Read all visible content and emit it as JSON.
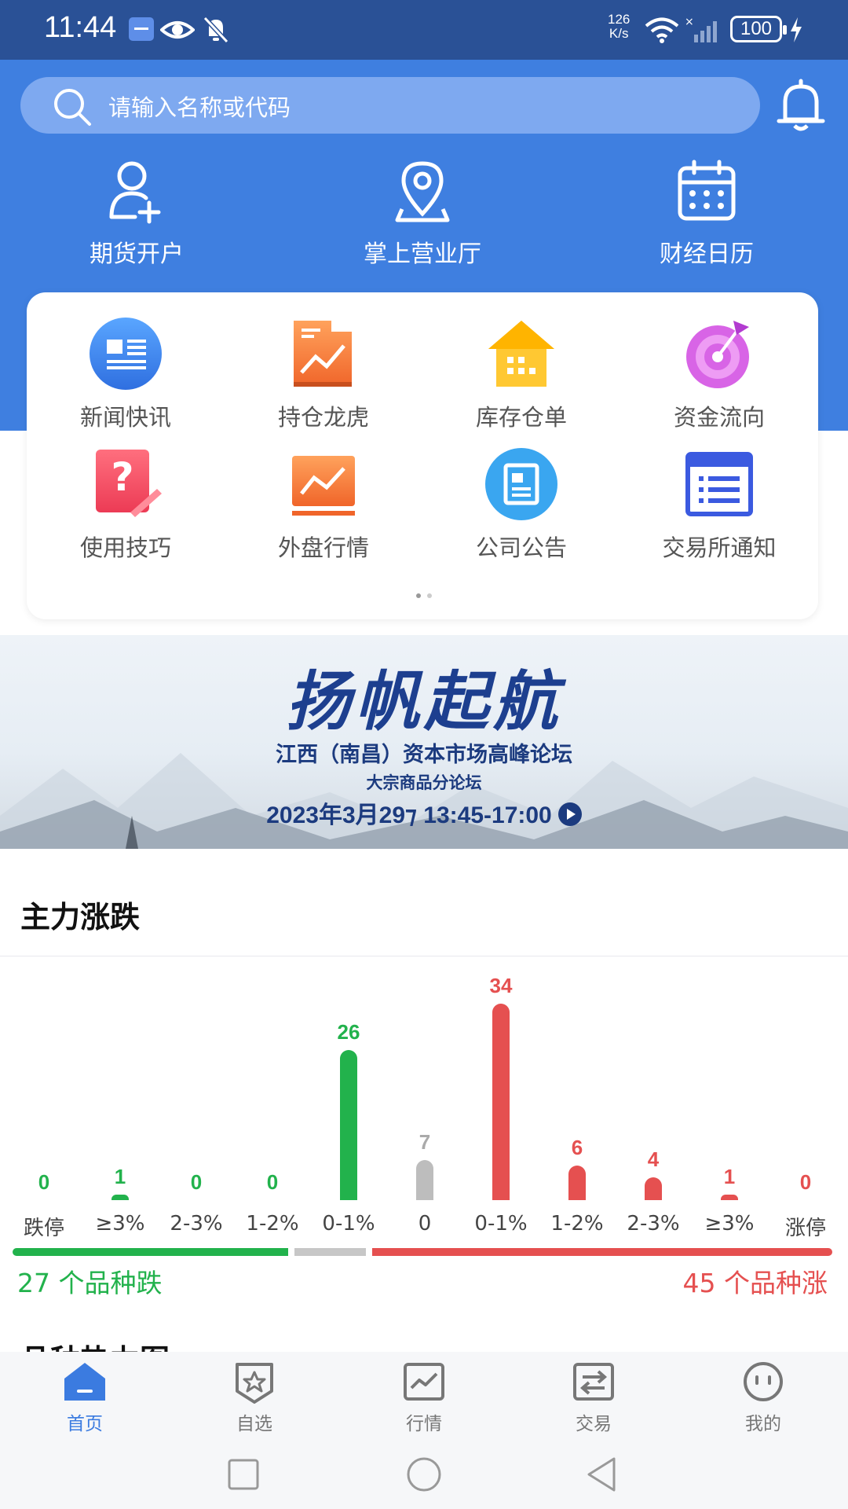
{
  "status_bar": {
    "time": "11:44",
    "net_speed_top": "126",
    "net_speed_bottom": "K/s",
    "battery": "100"
  },
  "search": {
    "placeholder": "请输入名称或代码"
  },
  "top_nav": [
    {
      "label": "期货开户",
      "icon": "add-user-icon"
    },
    {
      "label": "掌上营业厅",
      "icon": "location-pin-icon"
    },
    {
      "label": "财经日历",
      "icon": "calendar-icon"
    }
  ],
  "grid": [
    {
      "label": "新闻快讯",
      "icon": "news-icon"
    },
    {
      "label": "持仓龙虎",
      "icon": "position-chart-icon"
    },
    {
      "label": "库存仓单",
      "icon": "warehouse-icon"
    },
    {
      "label": "资金流向",
      "icon": "target-icon"
    },
    {
      "label": "使用技巧",
      "icon": "help-icon"
    },
    {
      "label": "外盘行情",
      "icon": "market-trend-icon"
    },
    {
      "label": "公司公告",
      "icon": "announcement-icon"
    },
    {
      "label": "交易所通知",
      "icon": "notice-list-icon"
    }
  ],
  "banner": {
    "title": "扬帆起航",
    "line1": "江西（南昌）资本市场高峰论坛",
    "line2": "大宗商品分论坛",
    "line3": "2023年3月29⁊  13:45-17:00"
  },
  "section_title": "主力涨跌",
  "chart_data": {
    "type": "bar",
    "categories": [
      "跌停",
      "≥3%",
      "2-3%",
      "1-2%",
      "0-1%",
      "0",
      "0-1%",
      "1-2%",
      "2-3%",
      "≥3%",
      "涨停"
    ],
    "values": [
      0,
      1,
      0,
      0,
      26,
      7,
      34,
      6,
      4,
      1,
      0
    ],
    "colors": [
      "#22b24c",
      "#22b24c",
      "#22b24c",
      "#22b24c",
      "#22b24c",
      "#bdbdbd",
      "#e55050",
      "#e55050",
      "#e55050",
      "#e55050",
      "#e55050"
    ],
    "ylim": [
      0,
      34
    ]
  },
  "distribution": {
    "fall": 27,
    "flat": 7,
    "rise": 45,
    "fall_color": "#22b24c",
    "flat_color": "#c7c7c7",
    "rise_color": "#e55050"
  },
  "counts": {
    "fall_text": "27 个品种跌",
    "rise_text": "45 个品种涨"
  },
  "next_section_title": "品种热力图",
  "tabs": [
    {
      "label": "首页",
      "icon": "home-icon",
      "active": true
    },
    {
      "label": "自选",
      "icon": "star-icon",
      "active": false
    },
    {
      "label": "行情",
      "icon": "chart-icon",
      "active": false
    },
    {
      "label": "交易",
      "icon": "exchange-icon",
      "active": false
    },
    {
      "label": "我的",
      "icon": "profile-icon",
      "active": false
    }
  ],
  "colors": {
    "brand_blue": "#3f7fe0",
    "status_bar": "#2a5196",
    "rise": "#e55050",
    "fall": "#22b24c"
  }
}
